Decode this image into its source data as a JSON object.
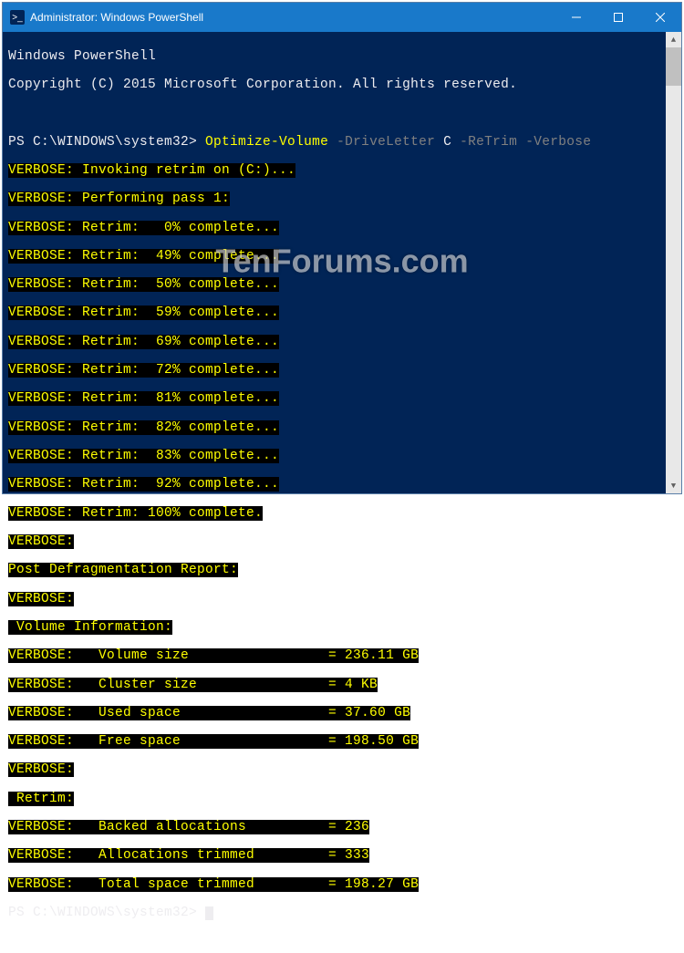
{
  "window": {
    "title": "Administrator: Windows PowerShell",
    "icon_label": ">_"
  },
  "header": {
    "line1": "Windows PowerShell",
    "line2": "Copyright (C) 2015 Microsoft Corporation. All rights reserved."
  },
  "prompt": {
    "text": "PS C:\\WINDOWS\\system32> ",
    "command": "Optimize-Volume",
    "param1": "-DriveLetter",
    "value1": "C",
    "param2": "-ReTrim",
    "param3": "-Verbose"
  },
  "output": {
    "l01": "VERBOSE: Invoking retrim on (C:)...",
    "l02": "VERBOSE: Performing pass 1:",
    "l03": "VERBOSE: Retrim:   0% complete...",
    "l04": "VERBOSE: Retrim:  49% complete...",
    "l05": "VERBOSE: Retrim:  50% complete...",
    "l06": "VERBOSE: Retrim:  59% complete...",
    "l07": "VERBOSE: Retrim:  69% complete...",
    "l08": "VERBOSE: Retrim:  72% complete...",
    "l09": "VERBOSE: Retrim:  81% complete...",
    "l10": "VERBOSE: Retrim:  82% complete...",
    "l11": "VERBOSE: Retrim:  83% complete...",
    "l12": "VERBOSE: Retrim:  92% complete...",
    "l13": "VERBOSE: Retrim: 100% complete.",
    "l14": "VERBOSE:",
    "l15": "Post Defragmentation Report:",
    "l16": "VERBOSE:",
    "l17": " Volume Information:",
    "l18": "VERBOSE:   Volume size                 = 236.11 GB",
    "l19": "VERBOSE:   Cluster size                = 4 KB",
    "l20": "VERBOSE:   Used space                  = 37.60 GB",
    "l21": "VERBOSE:   Free space                  = 198.50 GB",
    "l22": "VERBOSE:",
    "l23": " Retrim:",
    "l24": "VERBOSE:   Backed allocations          = 236",
    "l25": "VERBOSE:   Allocations trimmed         = 333",
    "l26": "VERBOSE:   Total space trimmed         = 198.27 GB"
  },
  "prompt2": {
    "text": "PS C:\\WINDOWS\\system32> "
  },
  "watermark": "TenForums.com"
}
